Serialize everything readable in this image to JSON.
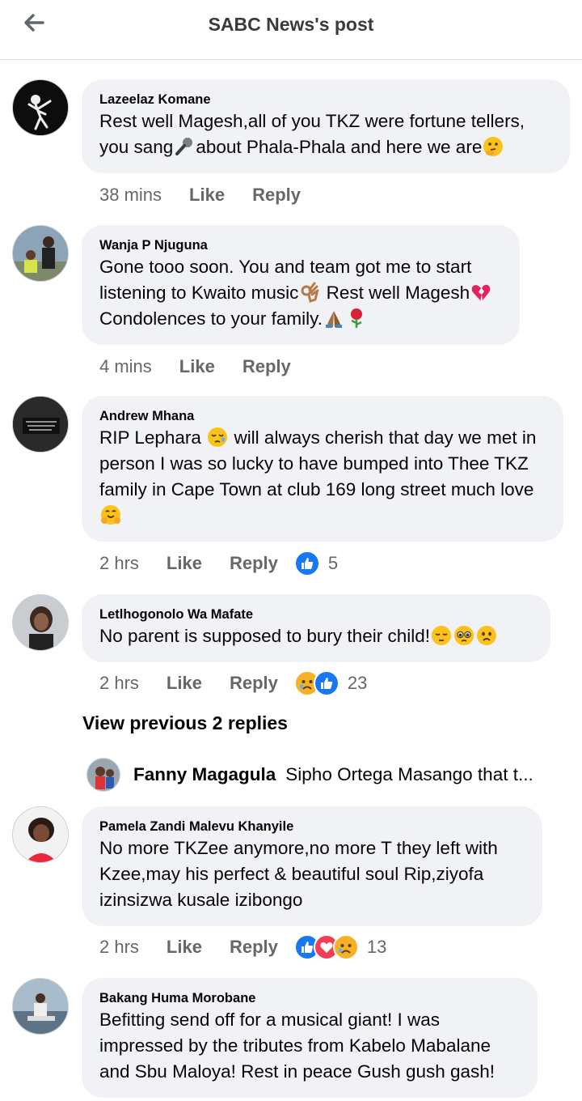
{
  "header": {
    "title": "SABC News's post"
  },
  "actions": {
    "like": "Like",
    "reply": "Reply"
  },
  "comments": [
    {
      "author": "Lazeelaz Komane",
      "text_parts": [
        "Rest well Magesh,all of you TKZ were fortune tellers, you sang",
        "about Phala-Phala and here we are"
      ],
      "time": "38 mins",
      "reaction_count": ""
    },
    {
      "author": "Wanja P Njuguna",
      "text_parts": [
        "Gone tooo soon. You and team got me to start listening to Kwaito music",
        " Rest well Magesh",
        "Condolences to your family."
      ],
      "time": "4 mins",
      "reaction_count": ""
    },
    {
      "author": "Andrew Mhana",
      "text_parts": [
        "RIP Lephara ",
        " will always cherish that day we met in person I was so lucky to have bumped into Thee TKZ family in Cape Town at club 169 long street much  love"
      ],
      "time": "2 hrs",
      "reaction_count": "5"
    },
    {
      "author": "Letlhogonolo Wa Mafate",
      "text_parts": [
        "No parent is supposed to bury their child!"
      ],
      "time": "2 hrs",
      "reaction_count": "23"
    },
    {
      "author": "Pamela Zandi Malevu Khanyile",
      "text_parts": [
        "No more TKZee anymore,no more T they left with Kzee,may his perfect & beautiful soul Rip,ziyofa izinsizwa kusale izibongo"
      ],
      "time": "2 hrs",
      "reaction_count": "13"
    },
    {
      "author": "Bakang Huma Morobane",
      "text_parts": [
        "Befitting send off for a musical giant! I was impressed by the tributes from Kabelo Mabalane and Sbu Maloya! Rest in peace Gush gush gash!"
      ],
      "time": "",
      "reaction_count": ""
    }
  ],
  "replies": {
    "view_previous": "View previous 2 replies",
    "preview": {
      "author": "Fanny Magagula",
      "text": "Sipho Ortega Masango that t..."
    }
  },
  "colors": {
    "like_blue": "#1877f2",
    "love_red": "#f33e58",
    "emoji_yellow": "#fcc21b",
    "bubble": "#f0f2f5",
    "meta_gray": "#65676b"
  },
  "icons": [
    "back-arrow-icon",
    "microphone-emoji",
    "thinking-emoji",
    "ok-hand-emoji",
    "broken-heart-emoji",
    "folded-hands-emoji",
    "rose-emoji",
    "sleepy-emoji",
    "hugging-emoji",
    "pensive-emoji",
    "pleading-emoji",
    "worried-emoji",
    "like-reaction-icon",
    "love-reaction-icon",
    "sad-reaction-icon"
  ]
}
